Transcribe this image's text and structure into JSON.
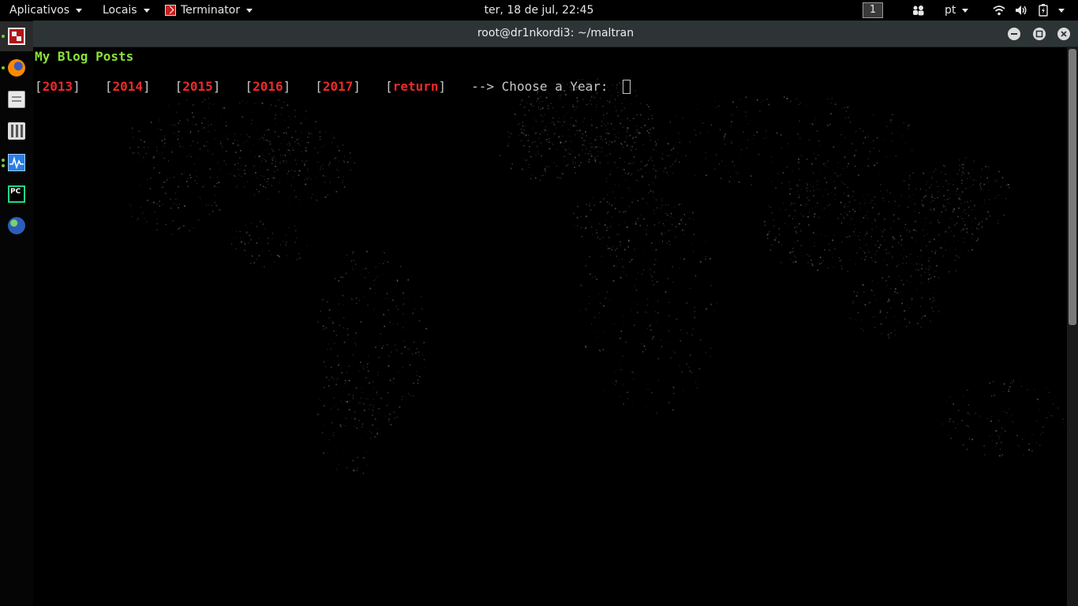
{
  "topbar": {
    "apps_label": "Aplicativos",
    "places_label": "Locais",
    "app_label": "Terminator",
    "clock": "ter, 18 de jul, 22:45",
    "workspace": "1",
    "language": "pt"
  },
  "dock": {
    "items": [
      "terminator-icon",
      "firefox-icon",
      "files-icon",
      "mixer-icon",
      "system-monitor-icon",
      "pycharm-icon",
      "globe-icon"
    ]
  },
  "window": {
    "title": "root@dr1nkordi3: ~/maltran"
  },
  "terminal": {
    "heading": "My Blog Posts",
    "menu_options": [
      "2013",
      "2014",
      "2015",
      "2016",
      "2017",
      "return"
    ],
    "prompt": "--> Choose a Year: ",
    "colors": {
      "heading": "#8ae234",
      "option": "#ef2929",
      "text": "#c7c7c7",
      "background": "#000000"
    }
  }
}
